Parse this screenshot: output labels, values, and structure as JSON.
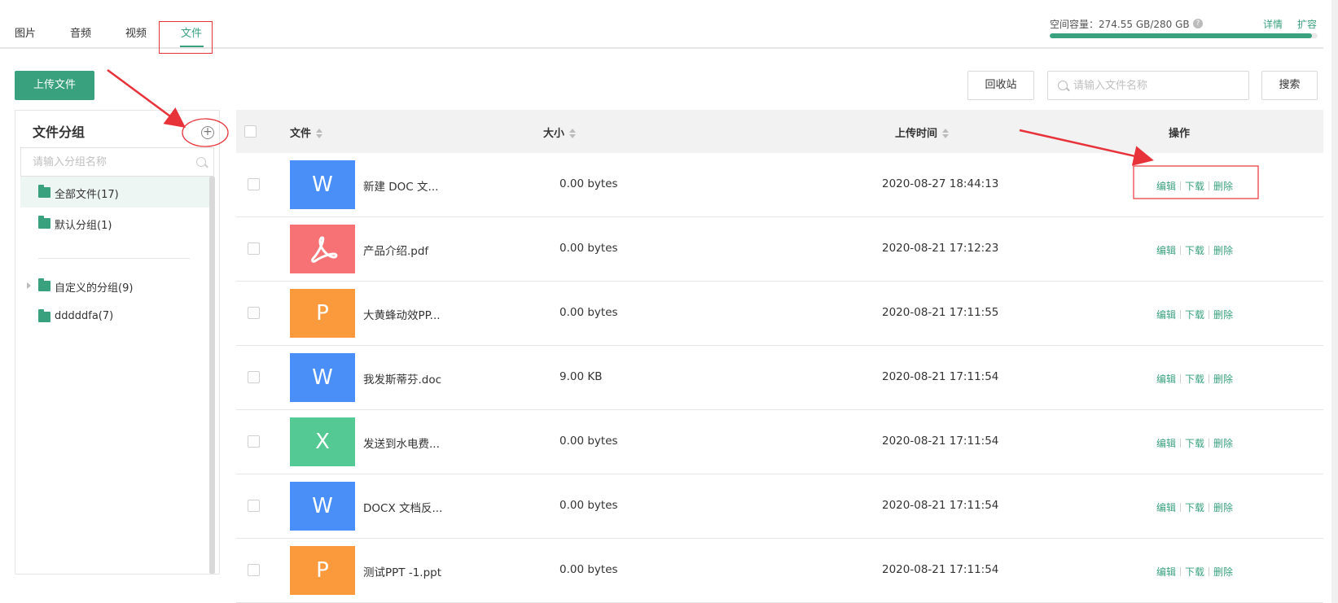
{
  "tabs": [
    {
      "label": "图片"
    },
    {
      "label": "音频"
    },
    {
      "label": "视频"
    },
    {
      "label": "文件"
    }
  ],
  "active_tab": "文件",
  "capacity": {
    "label": "空间容量：",
    "value": "274.55 GB/280 GB",
    "help_icon": "question-circle-icon",
    "used_fraction": 0.98,
    "details_link": "详情",
    "expand_link": "扩容"
  },
  "toolbar": {
    "upload_label": "上传文件",
    "recycle_label": "回收站",
    "search_placeholder": "请输入文件名称",
    "search_label": "搜索"
  },
  "sidebar": {
    "title": "文件分组",
    "add_icon": "plus-circle-icon",
    "search_placeholder": "请输入分组名称",
    "items": [
      {
        "label": "全部文件(17)",
        "icon": "folder-icon",
        "active": true
      },
      {
        "label": "默认分组(1)",
        "icon": "folder-icon"
      },
      {
        "label": "自定义的分组(9)",
        "icon": "folder-icon",
        "expandable": true
      },
      {
        "label": "dddddfa(7)",
        "icon": "folder-icon"
      }
    ]
  },
  "table": {
    "headers": {
      "file": "文件",
      "size": "大小",
      "upload_time": "上传时间",
      "actions": "操作"
    },
    "actions": {
      "edit": "编辑",
      "download": "下载",
      "delete": "删除"
    },
    "rows": [
      {
        "thumb_letter": "W",
        "thumb_color": "#4a8ff7",
        "name": "新建 DOC 文...",
        "size": "0.00 bytes",
        "time": "2020-08-27 18:44:13"
      },
      {
        "thumb_letter": "",
        "thumb_icon": "pdf-icon",
        "thumb_color": "#f77274",
        "name": "产品介绍.pdf",
        "size": "0.00 bytes",
        "time": "2020-08-21 17:12:23"
      },
      {
        "thumb_letter": "P",
        "thumb_color": "#fb9a3d",
        "name": "大黄蜂动效PP...",
        "size": "0.00 bytes",
        "time": "2020-08-21 17:11:55"
      },
      {
        "thumb_letter": "W",
        "thumb_color": "#4a8ff7",
        "name": "我发斯蒂芬.doc",
        "size": "9.00 KB",
        "time": "2020-08-21 17:11:54"
      },
      {
        "thumb_letter": "X",
        "thumb_color": "#55c994",
        "name": "发送到水电费...",
        "size": "0.00 bytes",
        "time": "2020-08-21 17:11:54"
      },
      {
        "thumb_letter": "W",
        "thumb_color": "#4a8ff7",
        "name": "DOCX 文档反...",
        "size": "0.00 bytes",
        "time": "2020-08-21 17:11:54"
      },
      {
        "thumb_letter": "P",
        "thumb_color": "#fb9a3d",
        "name": "测试PPT -1.ppt",
        "size": "0.00 bytes",
        "time": "2020-08-21 17:11:54"
      }
    ]
  },
  "colors": {
    "accent": "#3aa17e",
    "annotation": "#e8323a"
  }
}
